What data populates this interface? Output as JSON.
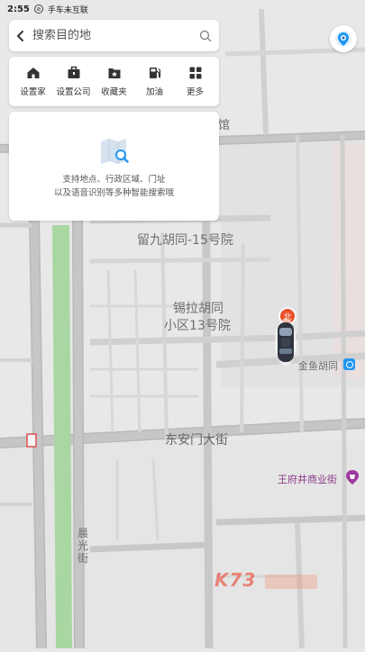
{
  "status_bar": {
    "time": "2:55",
    "connection_label": "手车未互联"
  },
  "search": {
    "placeholder": "搜索目的地"
  },
  "quick_actions": [
    {
      "label": "设置家",
      "icon": "home-icon"
    },
    {
      "label": "设置公司",
      "icon": "briefcase-icon"
    },
    {
      "label": "收藏夹",
      "icon": "star-folder-icon"
    },
    {
      "label": "加油",
      "icon": "gas-station-icon"
    },
    {
      "label": "更多",
      "icon": "grid-icon"
    }
  ],
  "tip": {
    "line1": "支持地点、行政区域、门址",
    "line2": "以及语音识别等多种智能搜索哦"
  },
  "map": {
    "labels": {
      "partial_top": "馆",
      "liujiu": "留九胡同-15号院",
      "xila_line1": "锡拉胡同",
      "xila_line2": "小区13号院",
      "jinyu": "金鱼胡同",
      "dongan": "东安门大街",
      "wangfujing": "王府井商业街",
      "chenguang": "晨光街"
    },
    "compass_label": "北",
    "watermark": "K73"
  },
  "colors": {
    "accent": "#2196f3",
    "park": "#a8d7a1",
    "compass": "#e8512b",
    "watermark": "#e8351e"
  }
}
